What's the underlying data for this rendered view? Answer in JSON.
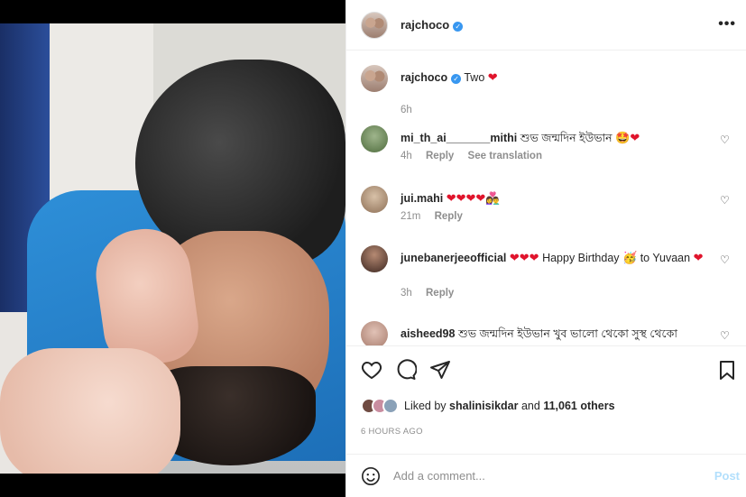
{
  "header": {
    "username": "rajchoco",
    "more_label": "•••"
  },
  "caption": {
    "username": "rajchoco",
    "text": "Two",
    "emoji": "❤",
    "time": "6h"
  },
  "comments": [
    {
      "username": "mi_th_ai_______mithi",
      "text": "শুভ জন্মদিন ইউভান",
      "emoji": "🤩❤",
      "time": "4h",
      "reply": "Reply",
      "translate": "See translation"
    },
    {
      "username": "jui.mahi",
      "text": "",
      "emoji": "❤❤❤❤👩‍❤️‍👨",
      "time": "21m",
      "reply": "Reply"
    },
    {
      "username": "junebanerjeeofficial",
      "text_a": "Happy Birthday",
      "emoji_a": "❤❤❤",
      "emoji_b": "🥳",
      "text_b": "to Yuvaan",
      "emoji_c": "❤",
      "time": "3h",
      "reply": "Reply"
    },
    {
      "username": "aisheed98",
      "text": "শুভ জন্মদিন ইউভান খুব ভালো থেকো সুস্থ থেকো"
    }
  ],
  "likes": {
    "prefix": "Liked by",
    "user": "shalinisikdar",
    "suffix": "and",
    "count": "11,061 others"
  },
  "timestamp": "6 HOURS AGO",
  "add_comment": {
    "placeholder": "Add a comment...",
    "post_label": "Post"
  },
  "colors": {
    "heart": "#e0142c",
    "verified": "#3897f0",
    "post": "#b2dffc",
    "muted": "#8e8e8e"
  }
}
